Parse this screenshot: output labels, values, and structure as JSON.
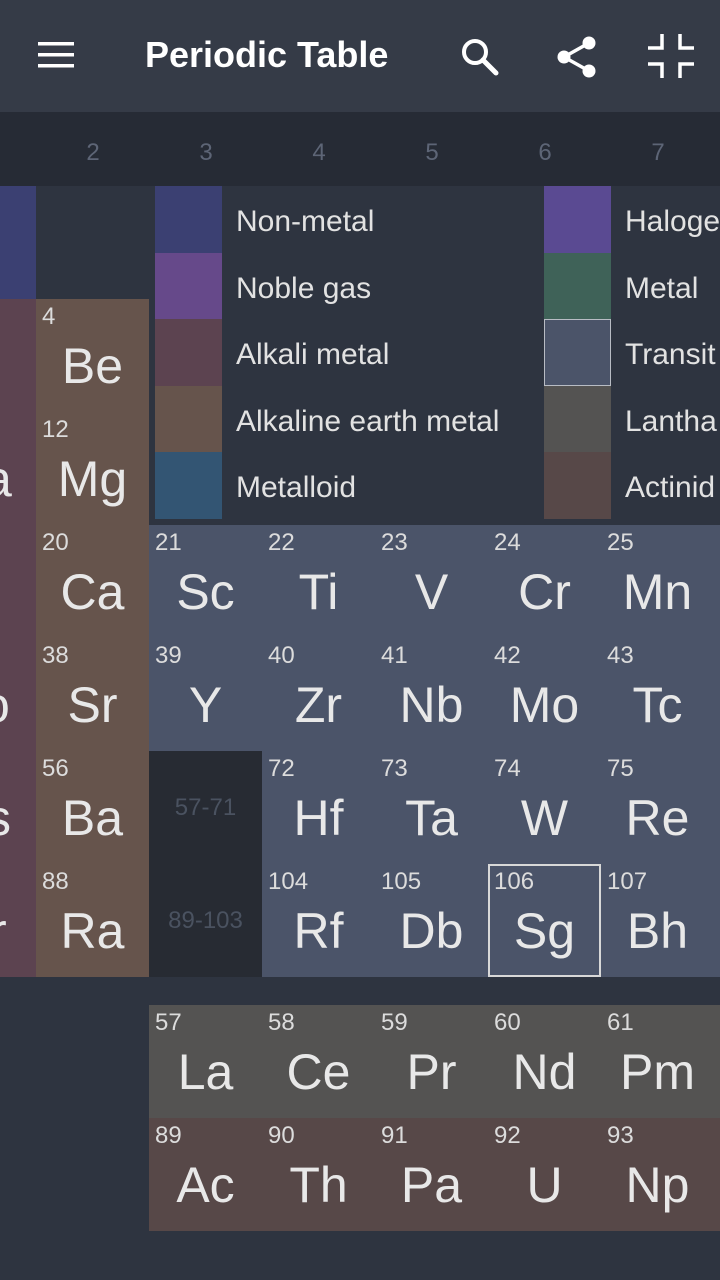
{
  "appbar": {
    "title": "Periodic Table",
    "icons": [
      "menu-icon",
      "search-icon",
      "share-icon",
      "fullscreen-exit-icon"
    ]
  },
  "groups": [
    "2",
    "3",
    "4",
    "5",
    "6",
    "7"
  ],
  "colors": {
    "nonmetal": "#3b4072",
    "noble_gas": "#66498a",
    "alkali_metal": "#5c4350",
    "alkaline_earth_metal": "#66544c",
    "metalloid": "#335573",
    "halogen": "#5a4a92",
    "metal": "#3f6258",
    "transition_metal": "#4b5469",
    "lanthanide": "#545352",
    "actinide": "#574848"
  },
  "legend": {
    "left": [
      "Non-metal",
      "Noble gas",
      "Alkali metal",
      "Alkaline earth metal",
      "Metalloid"
    ],
    "right": [
      "Haloge",
      "Metal",
      "Transit",
      "Lantha",
      "Actinid"
    ]
  },
  "group2": [
    {
      "num": "4",
      "sym": "Be"
    },
    {
      "num": "12",
      "sym": "Mg"
    },
    {
      "num": "20",
      "sym": "Ca"
    },
    {
      "num": "38",
      "sym": "Sr"
    },
    {
      "num": "56",
      "sym": "Ba"
    },
    {
      "num": "88",
      "sym": "Ra"
    }
  ],
  "partial_left": [
    "a",
    "o",
    "s",
    "r"
  ],
  "period4": [
    {
      "num": "21",
      "sym": "Sc"
    },
    {
      "num": "22",
      "sym": "Ti"
    },
    {
      "num": "23",
      "sym": "V"
    },
    {
      "num": "24",
      "sym": "Cr"
    },
    {
      "num": "25",
      "sym": "Mn"
    }
  ],
  "period5": [
    {
      "num": "39",
      "sym": "Y"
    },
    {
      "num": "40",
      "sym": "Zr"
    },
    {
      "num": "41",
      "sym": "Nb"
    },
    {
      "num": "42",
      "sym": "Mo"
    },
    {
      "num": "43",
      "sym": "Tc"
    }
  ],
  "period6": [
    {
      "num": "72",
      "sym": "Hf"
    },
    {
      "num": "73",
      "sym": "Ta"
    },
    {
      "num": "74",
      "sym": "W"
    },
    {
      "num": "75",
      "sym": "Re"
    }
  ],
  "period7": [
    {
      "num": "104",
      "sym": "Rf"
    },
    {
      "num": "105",
      "sym": "Db"
    },
    {
      "num": "106",
      "sym": "Sg"
    },
    {
      "num": "107",
      "sym": "Bh"
    }
  ],
  "placeholders": [
    "57-71",
    "89-103"
  ],
  "lanthanides": [
    {
      "num": "57",
      "sym": "La"
    },
    {
      "num": "58",
      "sym": "Ce"
    },
    {
      "num": "59",
      "sym": "Pr"
    },
    {
      "num": "60",
      "sym": "Nd"
    },
    {
      "num": "61",
      "sym": "Pm"
    }
  ],
  "actinides": [
    {
      "num": "89",
      "sym": "Ac"
    },
    {
      "num": "90",
      "sym": "Th"
    },
    {
      "num": "91",
      "sym": "Pa"
    },
    {
      "num": "92",
      "sym": "U"
    },
    {
      "num": "93",
      "sym": "Np"
    }
  ],
  "selected_element": "106"
}
